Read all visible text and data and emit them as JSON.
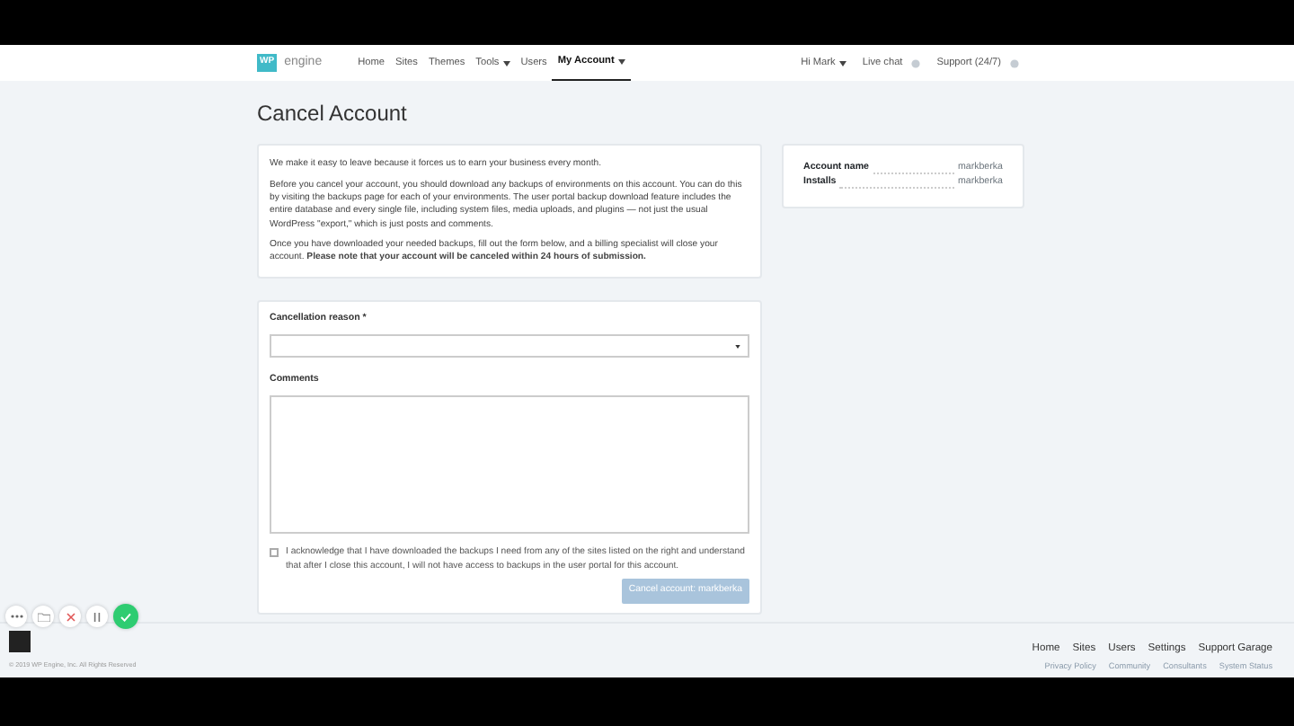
{
  "navbar": {
    "logo": {
      "mark": "WP",
      "word": "engine"
    },
    "links": [
      {
        "label": "Home",
        "dropdown": false,
        "selected": false
      },
      {
        "label": "Sites",
        "dropdown": false,
        "selected": false
      },
      {
        "label": "Themes",
        "dropdown": false,
        "selected": false
      },
      {
        "label": "Tools",
        "dropdown": true,
        "selected": false
      },
      {
        "label": "Users",
        "dropdown": false,
        "selected": false
      },
      {
        "label": "My Account",
        "dropdown": true,
        "selected": true
      }
    ],
    "right": [
      {
        "label": "Hi Mark",
        "kind": "dropdown"
      },
      {
        "label": "Live chat",
        "kind": "status"
      },
      {
        "label": "Support (24/7)",
        "kind": "status"
      }
    ]
  },
  "page": {
    "title": "Cancel Account"
  },
  "notice": {
    "paragraphs": [
      "We make it easy to leave because it forces us to earn your business every month.",
      "Before you cancel your account, you should download any backups of environments on this account. You can do this by visiting the backups page for each of your environments. The user portal backup download feature includes the entire database and every single file, including system files, media uploads, and plugins — not just the usual WordPress \"export,\" which is just posts and comments.",
      "Once you have downloaded your needed backups, fill out the form below, and a billing specialist will close your account. **Please note that your account will be canceled within 24 hours of submission.**"
    ]
  },
  "account": {
    "rows": [
      {
        "label": "Account name",
        "value": "markberka"
      },
      {
        "label": "Installs",
        "value": "markberka"
      }
    ]
  },
  "form": {
    "reason": {
      "label": "Cancellation reason *"
    },
    "comments": {
      "label": "Comments"
    },
    "acknowledge": {
      "text": "I acknowledge that I have downloaded the backups I need from any of the sites listed on the right and understand that after I close this account, I will not have access to backups in the user portal for this account.",
      "checked": false
    },
    "submit": {
      "label": "Cancel account: markberka",
      "disabled": true
    }
  },
  "footer": {
    "links": [
      "Home",
      "Sites",
      "Users",
      "Settings",
      "Support Garage"
    ],
    "secondary": [
      "Privacy Policy",
      "Community",
      "Consultants",
      "System Status"
    ],
    "copyright": "© 2019 WP Engine, Inc. All Rights Reserved"
  },
  "recorder": {
    "buttons": [
      {
        "kind": "more"
      },
      {
        "kind": "folder"
      },
      {
        "kind": "discard"
      },
      {
        "kind": "pause"
      },
      {
        "kind": "done"
      }
    ]
  }
}
